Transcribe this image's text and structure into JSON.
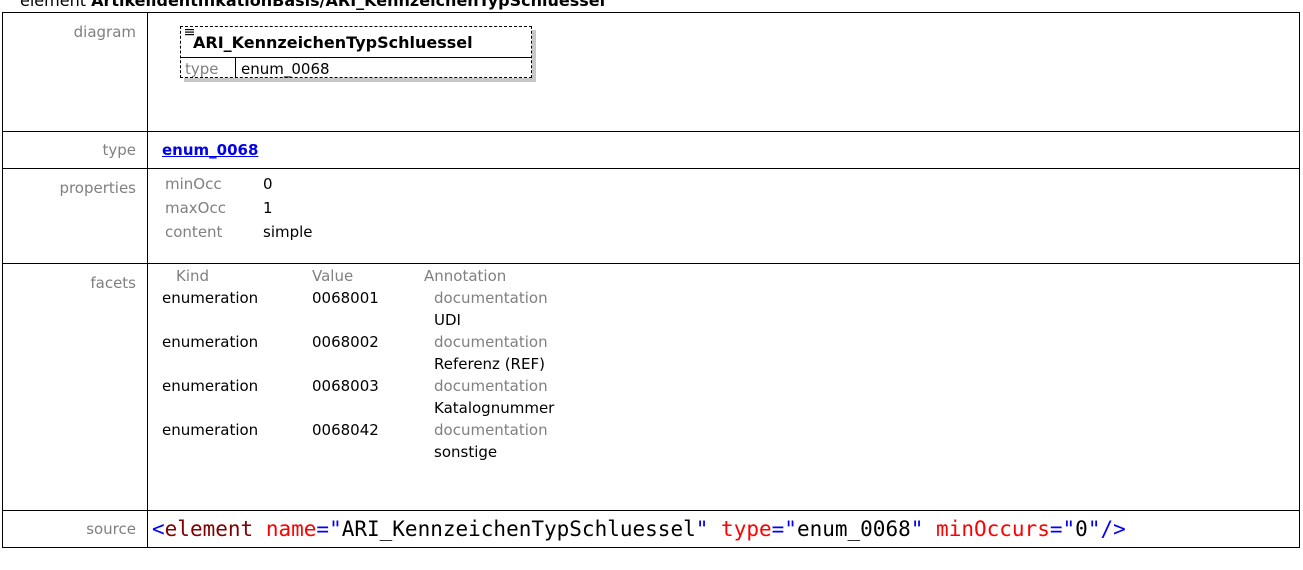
{
  "heading": {
    "prefix": "element ",
    "path": "ArtikelidentifikationBasis/ARI_KennzeichenTypSchluessel"
  },
  "labels": {
    "diagram": "diagram",
    "type": "type",
    "properties": "properties",
    "facets": "facets",
    "source": "source"
  },
  "diagram": {
    "icon": "list-icon",
    "element_name": "ARI_KennzeichenTypSchluessel",
    "type_label": "type",
    "type_value": "enum_0068"
  },
  "type": {
    "link": "enum_0068"
  },
  "properties": [
    {
      "key": "minOcc",
      "value": "0"
    },
    {
      "key": "maxOcc",
      "value": "1"
    },
    {
      "key": "content",
      "value": "simple"
    }
  ],
  "facets": {
    "headers": {
      "kind": "Kind",
      "value": "Value",
      "annotation": "Annotation"
    },
    "rows": [
      {
        "kind": "enumeration",
        "value": "0068001",
        "annotation_label": "documentation",
        "annotation_text": "UDI"
      },
      {
        "kind": "enumeration",
        "value": "0068002",
        "annotation_label": "documentation",
        "annotation_text": "Referenz (REF)"
      },
      {
        "kind": "enumeration",
        "value": "0068003",
        "annotation_label": "documentation",
        "annotation_text": "Katalognummer"
      },
      {
        "kind": "enumeration",
        "value": "0068042",
        "annotation_label": "documentation",
        "annotation_text": "sonstige"
      }
    ]
  },
  "source": {
    "open": "<",
    "tag": "element",
    "attr1_name": "name",
    "eq": "=",
    "q": "\"",
    "attr1_value": "ARI_KennzeichenTypSchluessel",
    "attr2_name": "type",
    "attr2_value": "enum_0068",
    "attr3_name": "minOccurs",
    "attr3_value": "0",
    "close": "/>"
  },
  "colors": {
    "link": "#0000ee",
    "label": "#808080",
    "source_tag": "#800000",
    "source_attr": "#ff0000",
    "source_punct": "#0000ff"
  }
}
